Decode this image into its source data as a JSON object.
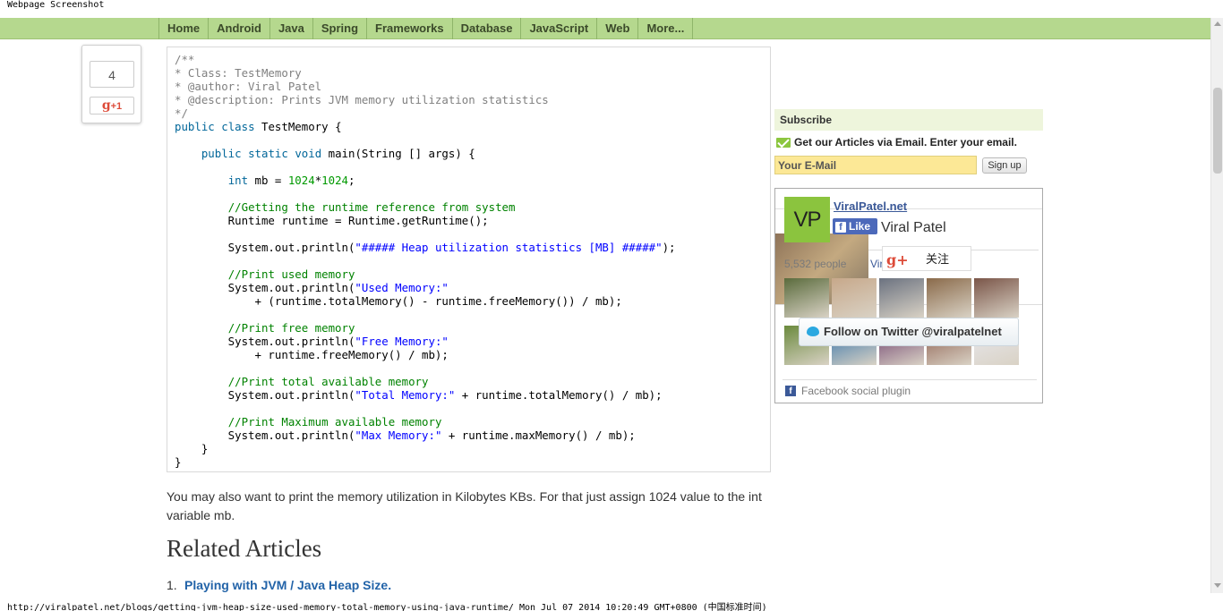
{
  "caption": {
    "title": "Webpage Screenshot",
    "footer": "http://viralpatel.net/blogs/getting-jvm-heap-size-used-memory-total-memory-using-java-runtime/ Mon Jul 07 2014 10:20:49 GMT+0800 (中国标准时间)"
  },
  "nav": {
    "items": [
      "Home",
      "Android",
      "Java",
      "Spring",
      "Frameworks",
      "Database",
      "JavaScript",
      "Web",
      "More..."
    ]
  },
  "share": {
    "count": "4",
    "gplus_g": "g",
    "gplus_plus": "+1"
  },
  "code": {
    "lines": [
      [
        {
          "c": "cmt",
          "t": "/**"
        }
      ],
      [
        {
          "c": "cmt",
          "t": "* Class: TestMemory"
        }
      ],
      [
        {
          "c": "cmt",
          "t": "* @author: Viral Patel"
        }
      ],
      [
        {
          "c": "cmt",
          "t": "* @description: Prints JVM memory utilization statistics"
        }
      ],
      [
        {
          "c": "cmt",
          "t": "*/"
        }
      ],
      [
        {
          "c": "kw",
          "t": "public"
        },
        {
          "c": "",
          "t": " "
        },
        {
          "c": "kw",
          "t": "class"
        },
        {
          "c": "",
          "t": " TestMemory {"
        }
      ],
      [
        {
          "c": "",
          "t": ""
        }
      ],
      [
        {
          "c": "",
          "t": "    "
        },
        {
          "c": "kw",
          "t": "public"
        },
        {
          "c": "",
          "t": " "
        },
        {
          "c": "kw",
          "t": "static"
        },
        {
          "c": "",
          "t": " "
        },
        {
          "c": "kw",
          "t": "void"
        },
        {
          "c": "",
          "t": " main(String [] args) {"
        }
      ],
      [
        {
          "c": "",
          "t": ""
        }
      ],
      [
        {
          "c": "",
          "t": "        "
        },
        {
          "c": "kw",
          "t": "int"
        },
        {
          "c": "",
          "t": " mb = "
        },
        {
          "c": "num",
          "t": "1024"
        },
        {
          "c": "",
          "t": "*"
        },
        {
          "c": "num",
          "t": "1024"
        },
        {
          "c": "",
          "t": ";"
        }
      ],
      [
        {
          "c": "",
          "t": ""
        }
      ],
      [
        {
          "c": "",
          "t": "        "
        },
        {
          "c": "cmt2",
          "t": "//Getting the runtime reference from system"
        }
      ],
      [
        {
          "c": "",
          "t": "        Runtime runtime = Runtime.getRuntime();"
        }
      ],
      [
        {
          "c": "",
          "t": ""
        }
      ],
      [
        {
          "c": "",
          "t": "        System.out.println("
        },
        {
          "c": "str",
          "t": "\"##### Heap utilization statistics [MB] #####\""
        },
        {
          "c": "",
          "t": ");"
        }
      ],
      [
        {
          "c": "",
          "t": ""
        }
      ],
      [
        {
          "c": "",
          "t": "        "
        },
        {
          "c": "cmt2",
          "t": "//Print used memory"
        }
      ],
      [
        {
          "c": "",
          "t": "        System.out.println("
        },
        {
          "c": "str",
          "t": "\"Used Memory:\""
        }
      ],
      [
        {
          "c": "",
          "t": "            + (runtime.totalMemory() - runtime.freeMemory()) / mb);"
        }
      ],
      [
        {
          "c": "",
          "t": ""
        }
      ],
      [
        {
          "c": "",
          "t": "        "
        },
        {
          "c": "cmt2",
          "t": "//Print free memory"
        }
      ],
      [
        {
          "c": "",
          "t": "        System.out.println("
        },
        {
          "c": "str",
          "t": "\"Free Memory:\""
        }
      ],
      [
        {
          "c": "",
          "t": "            + runtime.freeMemory() / mb);"
        }
      ],
      [
        {
          "c": "",
          "t": ""
        }
      ],
      [
        {
          "c": "",
          "t": "        "
        },
        {
          "c": "cmt2",
          "t": "//Print total available memory"
        }
      ],
      [
        {
          "c": "",
          "t": "        System.out.println("
        },
        {
          "c": "str",
          "t": "\"Total Memory:\""
        },
        {
          "c": "",
          "t": " + runtime.totalMemory() / mb);"
        }
      ],
      [
        {
          "c": "",
          "t": ""
        }
      ],
      [
        {
          "c": "",
          "t": "        "
        },
        {
          "c": "cmt2",
          "t": "//Print Maximum available memory"
        }
      ],
      [
        {
          "c": "",
          "t": "        System.out.println("
        },
        {
          "c": "str",
          "t": "\"Max Memory:\""
        },
        {
          "c": "",
          "t": " + runtime.maxMemory() / mb);"
        }
      ],
      [
        {
          "c": "",
          "t": "    }"
        }
      ],
      [
        {
          "c": "",
          "t": "}"
        }
      ]
    ]
  },
  "article": {
    "paragraph": "You may also want to print the memory utilization in Kilobytes KBs. For that just assign 1024 value to the int variable mb.",
    "related_heading": "Related Articles",
    "related": [
      {
        "num": "1.",
        "title": "Playing with JVM / Java Heap Size."
      }
    ]
  },
  "sidebar": {
    "subscribe_title": "Subscribe",
    "email_prompt": "Get our Articles via Email. Enter your email.",
    "email_placeholder": "Your E-Mail",
    "signup_label": "Sign up",
    "fb": {
      "page_name": "ViralPatel.net",
      "logo_text": "VP",
      "like_f": "f",
      "like_label": "Like",
      "owner_name": "Viral Patel",
      "gplus_g": "g+",
      "gplus_follow": "关注",
      "likes_text": "5,532 people",
      "likes_link": "ViralPatel.net",
      "twitter_label": "Follow on Twitter @viralpatelnet",
      "footer_f": "f",
      "footer": "Facebook social plugin"
    }
  },
  "colors": {
    "nav_bg": "#b5d88e",
    "link": "#2263a8",
    "fb_blue": "#3b5998",
    "email_bg": "#fce896"
  }
}
